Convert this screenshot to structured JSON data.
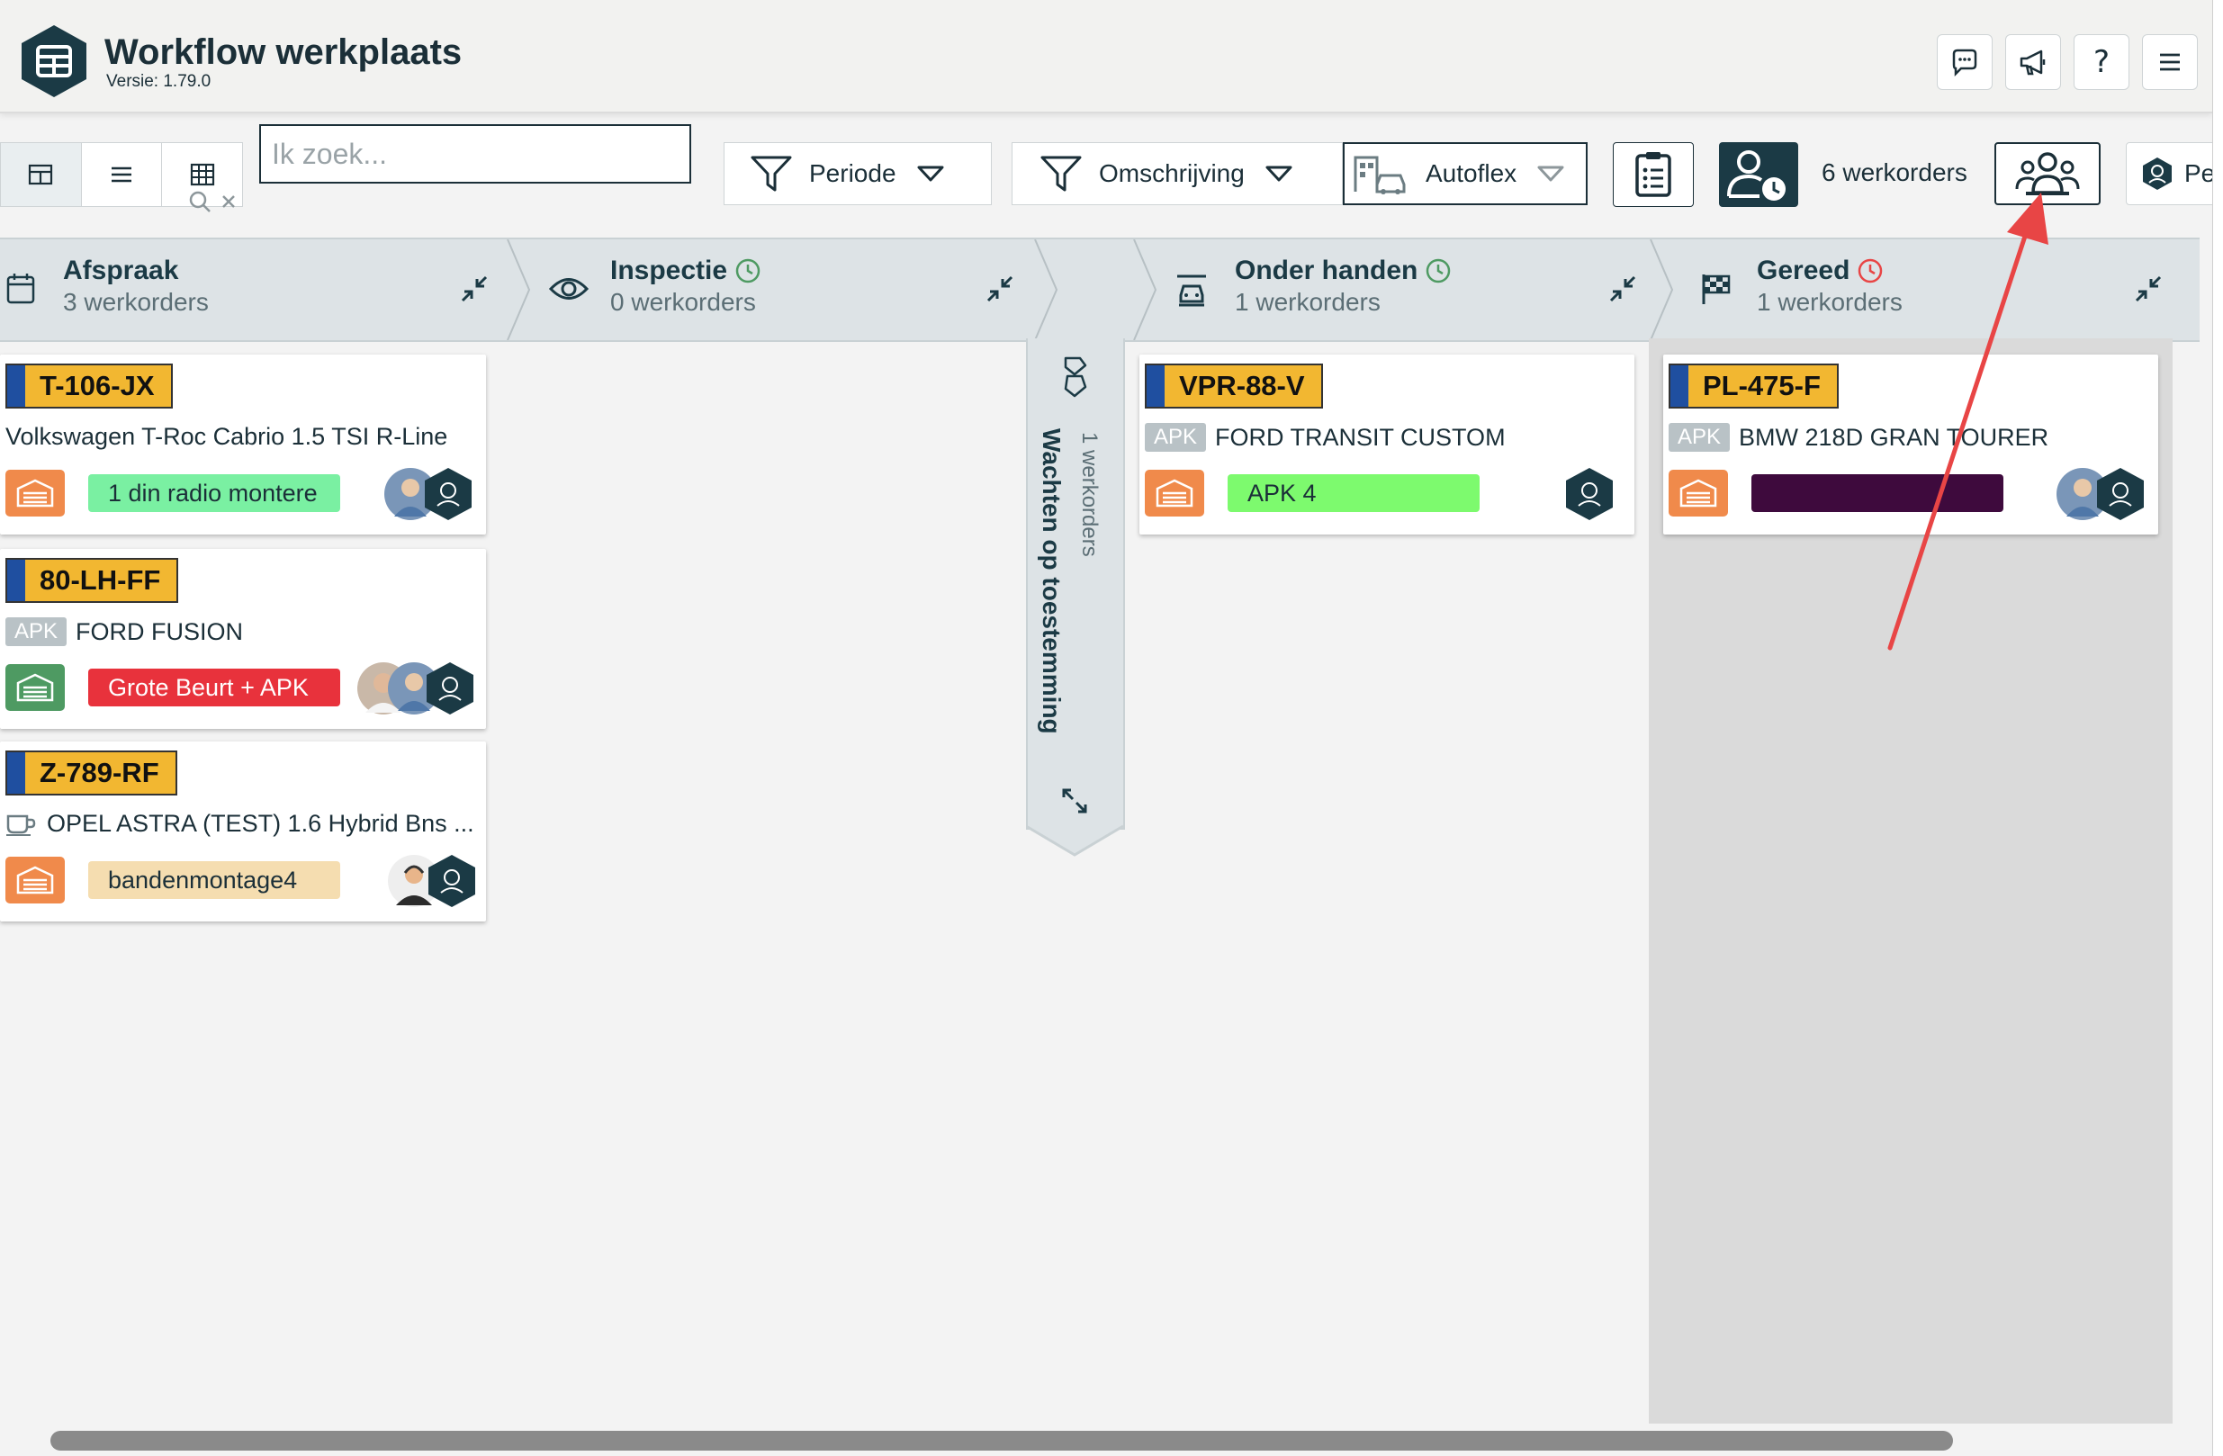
{
  "app": {
    "title": "Workflow werkplaats",
    "version": "Versie: 1.79.0"
  },
  "search": {
    "placeholder": "Ik zoek..."
  },
  "filters": {
    "periode": "Periode",
    "omschrijving": "Omschrijving",
    "autoflex": "Autoflex",
    "cut_label": "Pe"
  },
  "workorder_count": "6 werkorders",
  "columns": [
    {
      "title": "Afspraak",
      "count": "3 werkorders"
    },
    {
      "title": "Inspectie",
      "count": "0 werkorders"
    },
    {
      "title": "Onder handen",
      "count": "1 werkorders"
    },
    {
      "title": "Gereed",
      "count": "1 werkorders"
    }
  ],
  "wachten": {
    "title": "Wachten op toestemming",
    "count": "1 werkorders"
  },
  "cards": [
    {
      "plate": "T-106-JX",
      "car": "Volkswagen T-Roc Cabrio 1.5 TSI R-Line",
      "task": "1 din radio montere",
      "task_color": "#7af0a2",
      "garage_color": "#f08a4b"
    },
    {
      "plate": "80-LH-FF",
      "apk": "APK",
      "car": "FORD FUSION",
      "task": "Grote Beurt + APK",
      "task_color": "#e8323c",
      "garage_color": "#4e9a62"
    },
    {
      "plate": "Z-789-RF",
      "car": "OPEL ASTRA (TEST) 1.6 Hybrid Bns ...",
      "task": "bandenmontage4",
      "task_color": "#f5ddb0",
      "garage_color": "#f08a4b"
    },
    {
      "plate": "VPR-88-V",
      "apk": "APK",
      "car": "FORD TRANSIT CUSTOM",
      "task": "APK 4",
      "task_color": "#7dfa6e",
      "garage_color": "#f08a4b"
    },
    {
      "plate": "PL-475-F",
      "apk": "APK",
      "car": "BMW 218D GRAN TOURER",
      "task": "",
      "task_color": "#3e0a3d",
      "garage_color": "#f08a4b"
    }
  ],
  "colors": {
    "brand_dark": "#1b3a45",
    "plate_yellow": "#f2b731",
    "annotation_arrow": "#e84545"
  }
}
